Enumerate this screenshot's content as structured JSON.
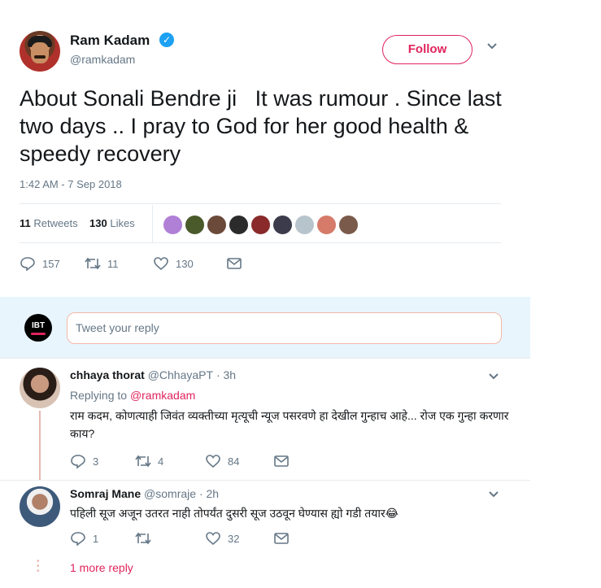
{
  "tweet": {
    "author_name": "Ram Kadam",
    "author_handle": "@ramkadam",
    "follow_label": "Follow",
    "text": "About Sonali Bendre ji   It was rumour . Since last two days .. I pray to God for her good health & speedy recovery",
    "timestamp": "1:42 AM - 7 Sep 2018",
    "retweets_count": "11",
    "retweets_label": "Retweets",
    "likes_count": "130",
    "likes_label": "Likes",
    "actions": {
      "replies": "157",
      "retweets": "11",
      "likes": "130"
    }
  },
  "reply_composer": {
    "avatar_label": "IBT",
    "placeholder": "Tweet your reply"
  },
  "replies": [
    {
      "name": "chhaya thorat",
      "handle": "@ChhayaPT",
      "time": "· 3h",
      "replying_prefix": "Replying to",
      "replying_to": "@ramkadam",
      "text": "राम कदम, कोणत्याही जिवंत व्यक्तीच्या मृत्यूची न्यूज पसरवणे हा देखील गुन्हाच आहे... रोज एक गुन्हा करणार काय?",
      "actions": {
        "replies": "3",
        "retweets": "4",
        "likes": "84"
      }
    },
    {
      "name": "Somraj Mane",
      "handle": "@somraje",
      "time": "· 2h",
      "text": "पहिली सूज अजून उतरत नाही तोपर्यंत दुसरी सूज उठवून घेण्यास ह्यो गडी तयार😂",
      "actions": {
        "replies": "1",
        "retweets": "",
        "likes": "32"
      }
    }
  ],
  "more_replies_label": "1 more reply",
  "colors": {
    "accent": "#e0245e",
    "verified": "#1da1f2",
    "muted": "#657786",
    "composer_bg": "#e8f5fd"
  },
  "icons": [
    "verified-icon",
    "chevron-down-icon",
    "reply-icon",
    "retweet-icon",
    "like-icon",
    "dm-icon"
  ]
}
